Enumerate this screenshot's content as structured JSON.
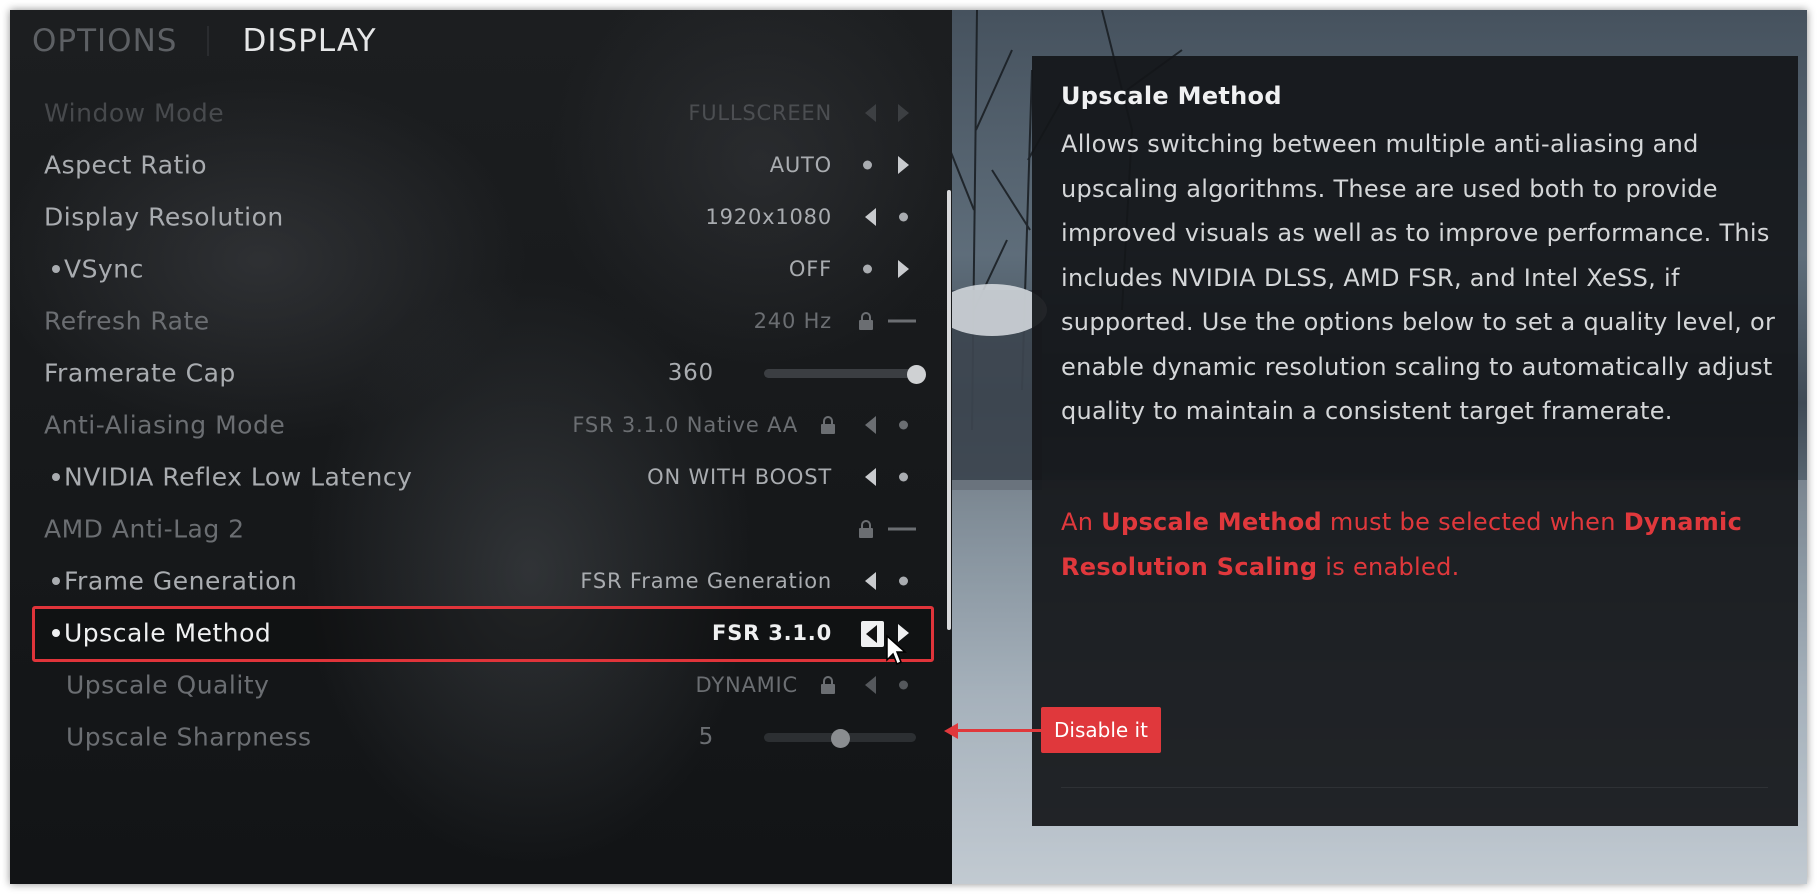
{
  "tabs": {
    "options": "OPTIONS",
    "display": "DISPLAY"
  },
  "settings": [
    {
      "label": "Window Mode",
      "value": "FULLSCREEN",
      "state": "dim",
      "bullet": false
    },
    {
      "label": "Aspect Ratio",
      "value": "AUTO",
      "state": "norm",
      "bullet": false
    },
    {
      "label": "Display Resolution",
      "value": "1920x1080",
      "state": "norm",
      "bullet": false
    },
    {
      "label": "VSync",
      "value": "OFF",
      "state": "norm",
      "bullet": true
    },
    {
      "label": "Refresh Rate",
      "value": "240 Hz",
      "state": "dim",
      "bullet": false
    },
    {
      "label": "Framerate Cap",
      "value": "360",
      "state": "norm",
      "bullet": false
    },
    {
      "label": "Anti-Aliasing Mode",
      "value": "FSR 3.1.0 Native AA",
      "state": "dim",
      "bullet": false
    },
    {
      "label": "NVIDIA Reflex Low Latency",
      "value": "ON WITH BOOST",
      "state": "norm",
      "bullet": true
    },
    {
      "label": "AMD Anti-Lag 2",
      "value": "",
      "state": "dim",
      "bullet": false
    },
    {
      "label": "Frame Generation",
      "value": "FSR Frame Generation",
      "state": "norm",
      "bullet": true
    },
    {
      "label": "Upscale Method",
      "value": "FSR 3.1.0",
      "state": "hi",
      "bullet": true
    },
    {
      "label": "Upscale Quality",
      "value": "DYNAMIC",
      "state": "dim",
      "bullet": false
    },
    {
      "label": "Upscale Sharpness",
      "value": "5",
      "state": "dim",
      "bullet": false
    }
  ],
  "sliders": {
    "framerate_cap_fraction": 1.0,
    "upscale_sharpness_fraction": 0.5
  },
  "info": {
    "title": "Upscale Method",
    "description": "Allows switching between multiple anti-aliasing and upscaling algorithms. These are used both to provide improved visuals as well as to improve performance. This includes NVIDIA DLSS, AMD FSR, and Intel XeSS, if supported. Use the options below to set a quality level, or enable dynamic resolution scaling to automatically adjust quality to maintain a consistent target framerate.",
    "warning_1": "An ",
    "warning_2": "Upscale Method",
    "warning_3": " must be selected when ",
    "warning_4": "Dynamic Resolution Scaling",
    "warning_5": " is enabled."
  },
  "callout": {
    "text": "Disable it"
  },
  "colors": {
    "accent_red": "#e0383c",
    "highlight_border": "#e0343a"
  }
}
